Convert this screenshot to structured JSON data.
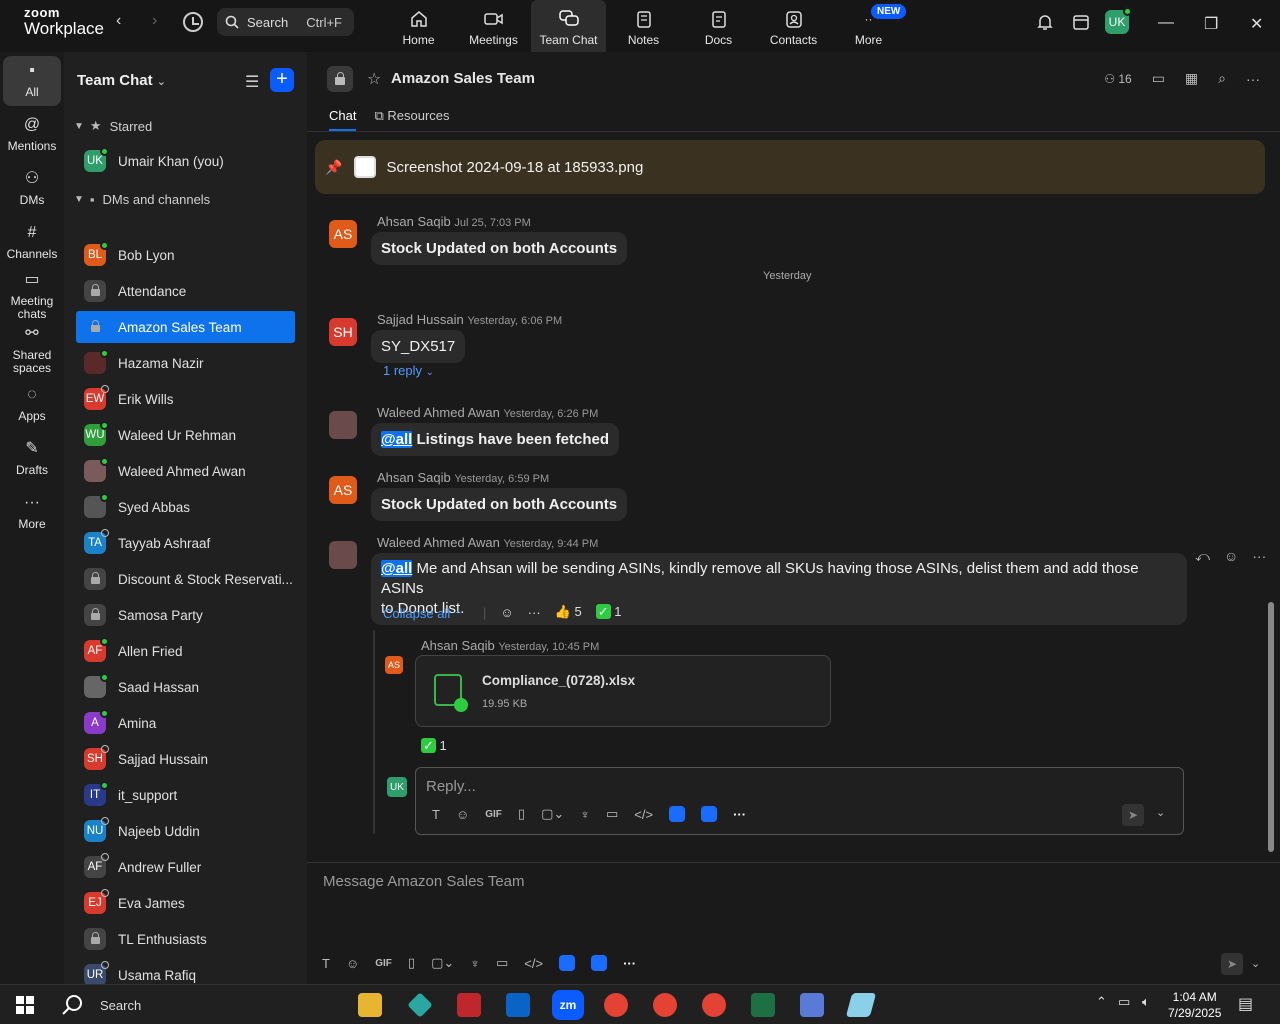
{
  "app": {
    "logo_top": "zoom",
    "logo_bottom": "Workplace"
  },
  "search": {
    "label": "Search",
    "shortcut": "Ctrl+F"
  },
  "topnav": [
    {
      "label": "Home",
      "icon": "home-icon"
    },
    {
      "label": "Meetings",
      "icon": "video-icon"
    },
    {
      "label": "Team Chat",
      "icon": "chat-icon",
      "active": true
    },
    {
      "label": "Notes",
      "icon": "notes-icon"
    },
    {
      "label": "Docs",
      "icon": "docs-icon"
    },
    {
      "label": "Contacts",
      "icon": "contacts-icon"
    },
    {
      "label": "More",
      "icon": "more-icon",
      "badge": "NEW"
    }
  ],
  "user": {
    "initials": "UK"
  },
  "rail": [
    {
      "label": "All",
      "active": true
    },
    {
      "label": "Mentions"
    },
    {
      "label": "DMs"
    },
    {
      "label": "Channels"
    },
    {
      "label": "Meeting chats"
    },
    {
      "label": "Shared spaces"
    },
    {
      "label": "Apps"
    },
    {
      "label": "Drafts"
    },
    {
      "label": "More"
    }
  ],
  "sidebar": {
    "title": "Team Chat",
    "starred_label": "Starred",
    "dms_label": "DMs and channels",
    "starred": [
      {
        "name": "Umair Khan (you)",
        "initials": "UK",
        "color": "#2e9f6a"
      }
    ],
    "items": [
      {
        "name": "Bob Lyon",
        "initials": "BL",
        "color": "#e05a1a"
      },
      {
        "name": "Attendance",
        "lock": true
      },
      {
        "name": "Amazon Sales Team",
        "lock": true,
        "active": true
      },
      {
        "name": "Hazama Nazir",
        "initials": "",
        "color": "#5a2a2a"
      },
      {
        "name": "Erik Wills",
        "initials": "EW",
        "color": "#d83a2e"
      },
      {
        "name": "Waleed Ur Rehman",
        "initials": "WU",
        "color": "#2e9f3a"
      },
      {
        "name": "Waleed Ahmed Awan",
        "initials": "",
        "color": "#7a5a5a"
      },
      {
        "name": "Syed Abbas",
        "initials": "",
        "color": "#555"
      },
      {
        "name": "Tayyab Ashraaf",
        "initials": "TA",
        "color": "#1a82c8"
      },
      {
        "name": "Discount & Stock Reservati...",
        "lock": true
      },
      {
        "name": "Samosa Party",
        "lock": true
      },
      {
        "name": "Allen Fried",
        "initials": "AF",
        "color": "#d83a2e"
      },
      {
        "name": "Saad Hassan",
        "initials": "",
        "color": "#666"
      },
      {
        "name": "Amina",
        "initials": "A",
        "color": "#8a3ac8"
      },
      {
        "name": "Sajjad Hussain",
        "initials": "SH",
        "color": "#d83a2e"
      },
      {
        "name": "it_support",
        "initials": "IT",
        "color": "#2a3a8a"
      },
      {
        "name": "Najeeb Uddin",
        "initials": "NU",
        "color": "#1a82c8"
      },
      {
        "name": "Andrew Fuller",
        "initials": "AF",
        "color": "#444"
      },
      {
        "name": "Eva James",
        "initials": "EJ",
        "color": "#d83a2e"
      },
      {
        "name": "TL Enthusiasts",
        "lock": true
      },
      {
        "name": "Usama Rafiq",
        "initials": "UR",
        "color": "#3a4a6a"
      }
    ]
  },
  "channel": {
    "title": "Amazon Sales Team",
    "members": "16",
    "tabs": [
      "Chat",
      "Resources"
    ]
  },
  "pinned": {
    "text": "Screenshot 2024-09-18 at 185933.png"
  },
  "day_separator": "Yesterday",
  "messages": [
    {
      "author": "Ahsan Saqib",
      "time": "Jul 25, 7:03 PM",
      "initials": "AS",
      "text": "Stock Updated on both Accounts"
    },
    {
      "author": "Sajjad Hussain",
      "time": "Yesterday, 6:06 PM",
      "initials": "SH",
      "text": "SY_DX517",
      "replies": "1 reply"
    },
    {
      "author": "Waleed Ahmed Awan",
      "time": "Yesterday, 6:26 PM",
      "mention": "@all",
      "text": " Listings have been fetched"
    },
    {
      "author": "Ahsan Saqib",
      "time": "Yesterday, 6:59 PM",
      "initials": "AS",
      "text": "Stock Updated on both Accounts"
    },
    {
      "author": "Waleed Ahmed Awan",
      "time": "Yesterday, 9:44 PM",
      "mention": "@all",
      "text_line1": " Me and Ahsan will be sending ASINs, kindly remove all SKUs having those ASINs, delist them and add those ASINs",
      "text_line2": "to Donot list."
    }
  ],
  "thread": {
    "collapse_label": "Collapse all",
    "reaction1_count": "5",
    "reaction2_count": "1",
    "reply_author": "Ahsan Saqib",
    "reply_time": "Yesterday, 10:45 PM",
    "reply_initials": "AS",
    "file_name": "Compliance_(0728).xlsx",
    "file_size": "19.95 KB",
    "file_reaction_count": "1",
    "reply_placeholder": "Reply..."
  },
  "composer": {
    "placeholder": "Message Amazon Sales Team"
  },
  "taskbar": {
    "search": "Search",
    "time": "1:04 AM",
    "date": "7/29/2025"
  }
}
